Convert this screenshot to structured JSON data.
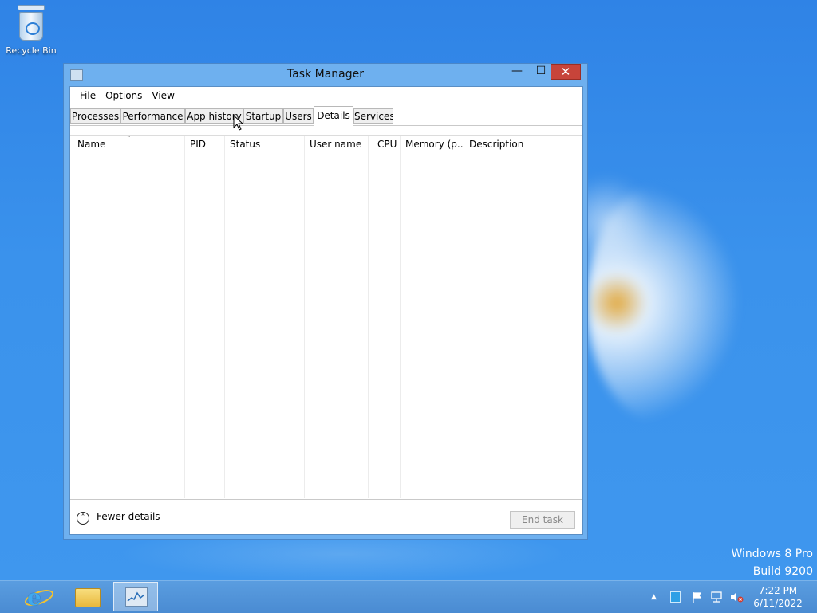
{
  "desktop": {
    "recycle_bin_label": "Recycle Bin",
    "watermark": {
      "line1": "Windows 8 Pro",
      "line2": "Build 9200"
    }
  },
  "window": {
    "title": "Task Manager",
    "controls": {
      "minimize": "—",
      "maximize": "☐",
      "close": "✕"
    },
    "menu": [
      "File",
      "Options",
      "View"
    ],
    "tabs": [
      "Processes",
      "Performance",
      "App history",
      "Startup",
      "Users",
      "Details",
      "Services"
    ],
    "active_tab": "Details",
    "columns": [
      "Name",
      "PID",
      "Status",
      "User name",
      "CPU",
      "Memory (p...",
      "Description"
    ],
    "sort_indicator": "˄",
    "footer": {
      "fewer_details": "Fewer details",
      "end_task": "End task",
      "fewer_icon": "˄"
    }
  },
  "taskbar": {
    "apps": [
      {
        "name": "internet-explorer",
        "label": "e"
      },
      {
        "name": "file-explorer",
        "label": ""
      },
      {
        "name": "task-manager",
        "label": ""
      }
    ],
    "tray": {
      "overflow": "▲",
      "time": "7:22 PM",
      "date": "6/11/2022"
    }
  },
  "colors": {
    "close_button": "#c7443a",
    "desktop": "#3a8ee8",
    "window_frame": "#6eb0ef"
  }
}
